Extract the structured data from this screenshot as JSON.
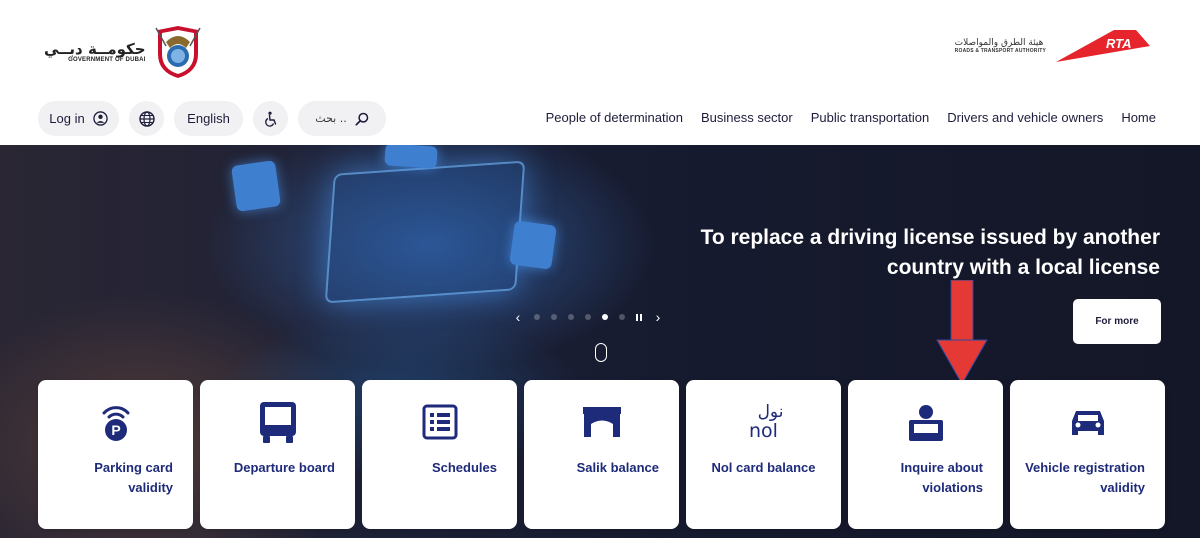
{
  "header": {
    "gov_logo_ar": "حكومــة دبــي",
    "gov_logo_en": "GOVERNMENT OF DUBAI",
    "rta_logo_ar": "هيئة الطرق والمواصلات",
    "rta_logo_en": "ROADS & TRANSPORT AUTHORITY",
    "rta_mark": "RTA"
  },
  "controls": {
    "login_label": "Log in",
    "language_label": "English",
    "search_placeholder": "بحث .."
  },
  "nav": {
    "items": [
      "People of determination",
      "Business sector",
      "Public transportation",
      "Drivers and vehicle owners",
      "Home"
    ]
  },
  "hero": {
    "title": "To replace a driving license issued by another country with a local license",
    "cta_label": "For more",
    "slide_count": 6,
    "active_slide": 4
  },
  "services": [
    {
      "label": "Parking card validity",
      "icon": "parking-signal-icon"
    },
    {
      "label": "Departure board",
      "icon": "bus-icon"
    },
    {
      "label": "Schedules",
      "icon": "schedule-list-icon"
    },
    {
      "label": "Salik balance",
      "icon": "toll-gate-icon"
    },
    {
      "label": "Nol card balance",
      "icon": "nol-logo-icon",
      "logo_ar": "نول",
      "logo_en": "nol"
    },
    {
      "label": "Inquire about violations",
      "icon": "violation-officer-icon"
    },
    {
      "label": "Vehicle registration validity",
      "icon": "car-icon"
    }
  ],
  "colors": {
    "accent": "#1e2a7a",
    "annotation_arrow": "#e53935",
    "rta_red": "#e5242b"
  }
}
